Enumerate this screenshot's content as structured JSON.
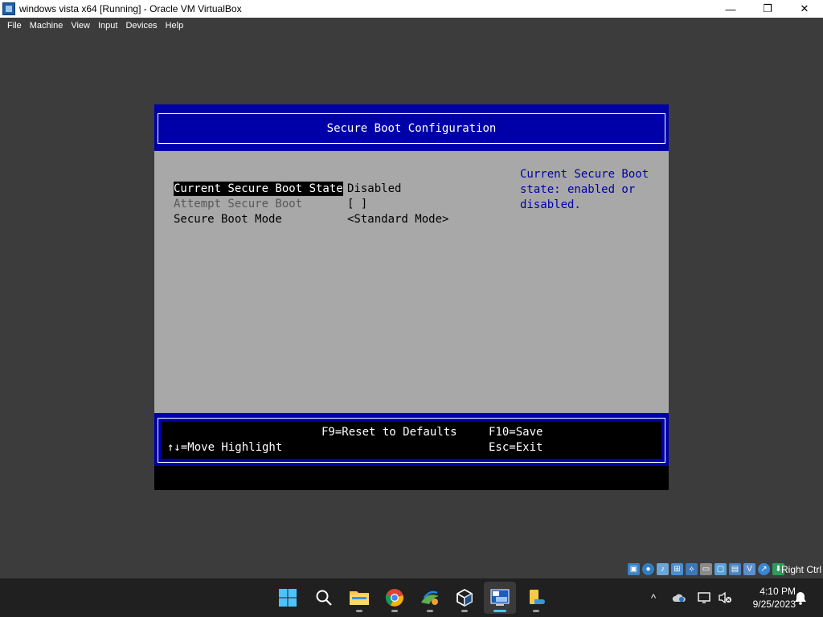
{
  "window": {
    "title": "windows vista x64 [Running] - Oracle VM VirtualBox",
    "minimize": "—",
    "maximize": "❐",
    "close": "✕"
  },
  "menu": [
    "File",
    "Machine",
    "View",
    "Input",
    "Devices",
    "Help"
  ],
  "bios": {
    "header": "Secure Boot Configuration",
    "options": [
      {
        "label": "Current Secure Boot State",
        "value": "Disabled",
        "state": "selected"
      },
      {
        "label": "Attempt Secure Boot",
        "value": "[ ]",
        "state": "disabled"
      },
      {
        "label": "Secure Boot Mode",
        "value": "<Standard Mode>",
        "state": "normal"
      }
    ],
    "help": [
      "Current Secure Boot",
      "state: enabled or",
      "disabled."
    ],
    "footer": {
      "reset": "F9=Reset to Defaults",
      "save": "F10=Save",
      "move": "↑↓=Move Highlight",
      "exit": "Esc=Exit"
    }
  },
  "status_bar": {
    "host_key": "Right Ctrl",
    "icons": [
      "hard-disk-icon",
      "optical-drive-icon",
      "audio-icon",
      "network-icon",
      "usb-icon",
      "shared-folders-icon",
      "display-icon",
      "video-capture-icon",
      "cpu-icon",
      "mouse-integration-icon",
      "keyboard-capture-icon"
    ]
  },
  "taskbar": {
    "apps": [
      "start-icon",
      "search-icon",
      "file-explorer-icon",
      "chrome-icon",
      "photos-icon",
      "virtualbox-icon",
      "vista-vm-icon",
      "files-icon"
    ],
    "active_app": "vista-vm-icon",
    "tray": {
      "chevron": "^",
      "time": "4:10 PM",
      "date": "9/25/2023"
    }
  }
}
